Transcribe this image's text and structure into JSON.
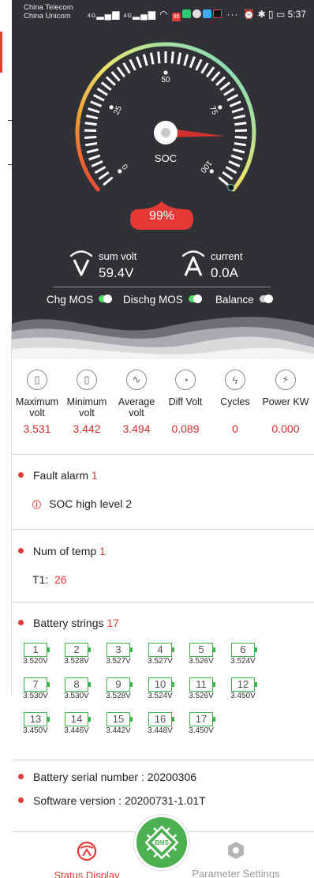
{
  "status_bar": {
    "carrier1": "China Telecom",
    "carrier2": "China Unicom",
    "net1": "4G",
    "net2": "4G",
    "badge": "86",
    "more": "···",
    "time": "5:37"
  },
  "gauge": {
    "label": "SOC",
    "scale": [
      "0",
      "25",
      "50",
      "75",
      "100"
    ],
    "value_percent": 99,
    "value_text": "99%"
  },
  "meters": {
    "sum_volt_label": "sum volt",
    "sum_volt_value": "59.4V",
    "current_label": "current",
    "current_value": "0.0A"
  },
  "mos": {
    "chg_label": "Chg MOS",
    "chg_on": true,
    "dischg_label": "Dischg MOS",
    "dischg_on": true,
    "balance_label": "Balance",
    "balance_on": false
  },
  "stats": [
    {
      "name": "Maximum volt",
      "value": "3.531",
      "icon": "battery-cell-icon"
    },
    {
      "name": "Minimum volt",
      "value": "3.442",
      "icon": "battery-cell-icon"
    },
    {
      "name": "Average volt",
      "value": "3.494",
      "icon": "sine-wave-icon"
    },
    {
      "name": "Diff Volt",
      "value": "0.089",
      "icon": "gauge-icon"
    },
    {
      "name": "Cycles",
      "value": "0",
      "icon": "cycle-bolt-icon"
    },
    {
      "name": "Power KW",
      "value": "0.000",
      "icon": "power-pulse-icon"
    }
  ],
  "fault": {
    "title": "Fault alarm",
    "count": "1",
    "items": [
      "SOC high level 2"
    ]
  },
  "temp": {
    "title": "Num of temp",
    "count": "1",
    "items": [
      {
        "label": "T1:",
        "value": "26"
      }
    ]
  },
  "strings": {
    "title": "Battery strings",
    "count": "17",
    "cells": [
      {
        "n": "1",
        "v": "3.520V"
      },
      {
        "n": "2",
        "v": "3.528V"
      },
      {
        "n": "3",
        "v": "3.527V"
      },
      {
        "n": "4",
        "v": "3.527V"
      },
      {
        "n": "5",
        "v": "3.526V"
      },
      {
        "n": "6",
        "v": "3.524V"
      },
      {
        "n": "7",
        "v": "3.530V"
      },
      {
        "n": "8",
        "v": "3.530V"
      },
      {
        "n": "9",
        "v": "3.528V"
      },
      {
        "n": "10",
        "v": "3.524V"
      },
      {
        "n": "11",
        "v": "3.526V"
      },
      {
        "n": "12",
        "v": "3.450V"
      },
      {
        "n": "13",
        "v": "3.450V"
      },
      {
        "n": "14",
        "v": "3.446V"
      },
      {
        "n": "15",
        "v": "3.442V"
      },
      {
        "n": "16",
        "v": "3.448V"
      },
      {
        "n": "17",
        "v": "3.450V"
      }
    ]
  },
  "info": {
    "serial_label": "Battery serial number :",
    "serial_value": "20200306",
    "software_label": "Software version :",
    "software_value": "20200731-1.01T"
  },
  "nav": {
    "left_label": "Status Display",
    "center_label": "BMS",
    "right_label": "Parameter Settings"
  },
  "colors": {
    "accent_red": "#e53935",
    "toggle_on": "#4cd964",
    "cell_green": "#3cb44b",
    "bms_green": "#4caf50",
    "dark_bg": "#2f3137"
  }
}
